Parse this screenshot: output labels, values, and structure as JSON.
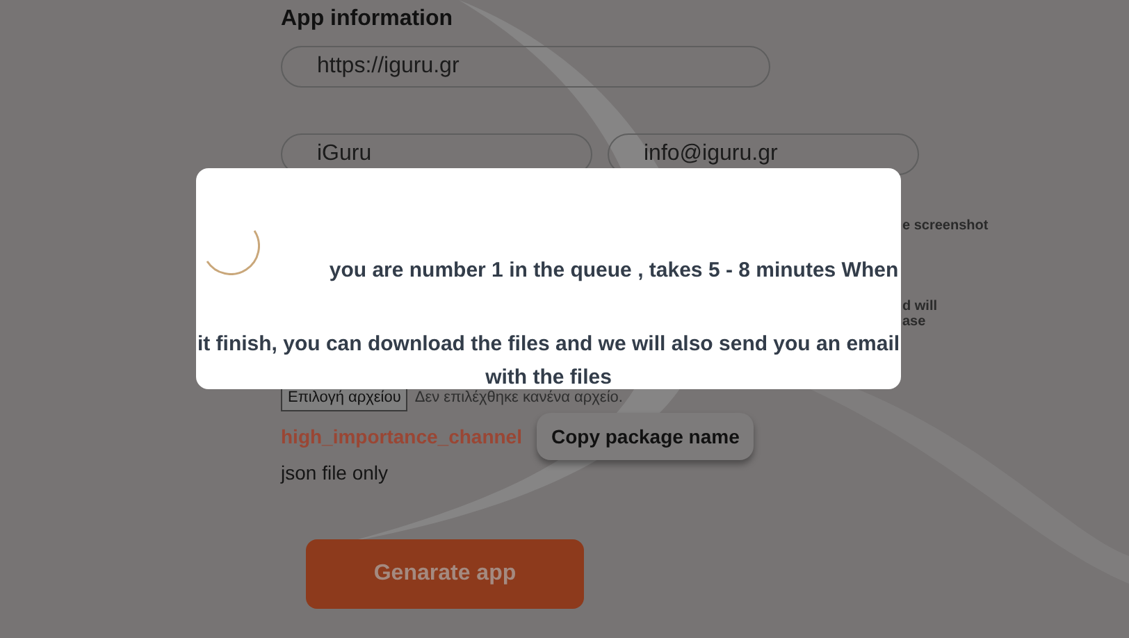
{
  "section_title": "App information",
  "url_field": {
    "value": "https://iguru.gr"
  },
  "name_field": {
    "value": "iGuru"
  },
  "email_field": {
    "value": "info@iguru.gr"
  },
  "hidden_notes": [
    "e screenshot",
    "d will",
    "ase"
  ],
  "file_input": {
    "button": "Επιλογή αρχείου",
    "status": "Δεν επιλέχθηκε κανένα αρχείο."
  },
  "channel_name": "high_importance_channel",
  "copy_button": "Copy package name",
  "file_hint": "json file only",
  "generate_button": "Genarate app",
  "modal": {
    "message": "you are number 1 in the queue , takes 5 - 8 minutes When it finish, you can download the files and we will also send you an email with the files"
  }
}
